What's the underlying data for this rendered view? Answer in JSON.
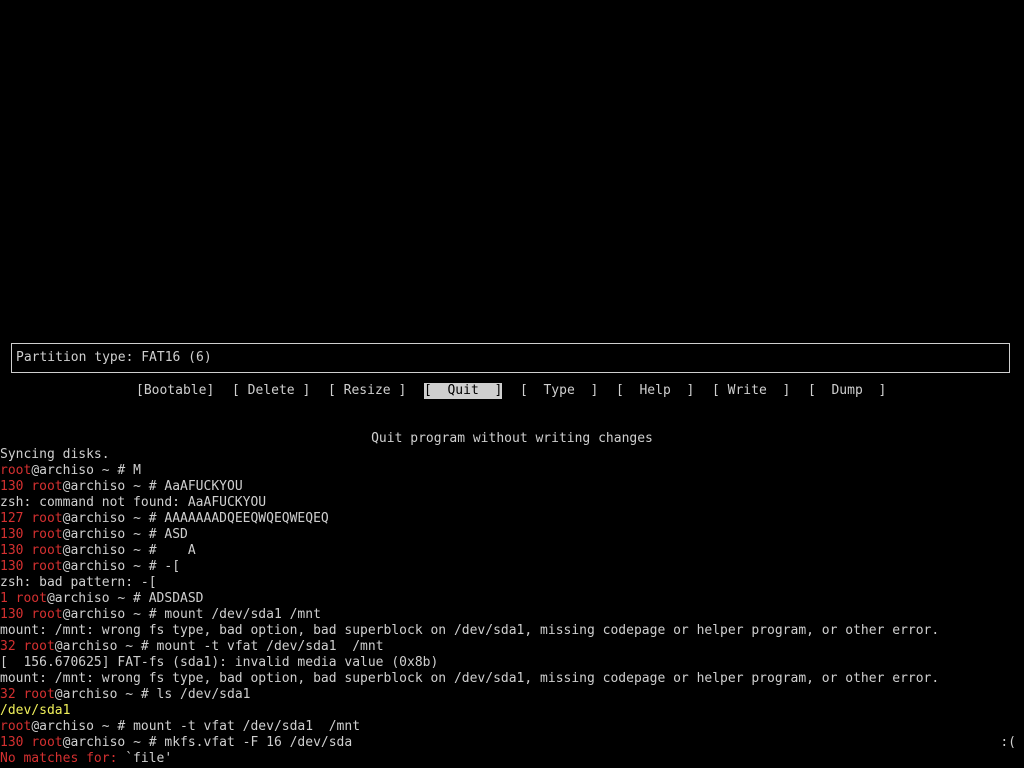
{
  "partition": {
    "type_line": "Partition type: FAT16 (6)"
  },
  "menu": {
    "items": [
      {
        "label": "[Bootable]"
      },
      {
        "label": "[ Delete ]"
      },
      {
        "label": "[ Resize ]"
      },
      {
        "label": "[  Quit  ]"
      },
      {
        "label": "[  Type  ]"
      },
      {
        "label": "[  Help  ]"
      },
      {
        "label": "[ Write  ]"
      },
      {
        "label": "[  Dump  ]"
      }
    ],
    "selected": "Quit"
  },
  "hint": "Quit program without writing changes",
  "terminal": {
    "lines": [
      {
        "text": "Syncing disks."
      },
      {
        "user": "root",
        "host": "@archiso ~ # ",
        "cmd": "M"
      },
      {
        "status": "130 ",
        "user": "root",
        "host": "@archiso ~ # ",
        "cmd": "AaAFUCKYOU"
      },
      {
        "text": "zsh: command not found: AaAFUCKYOU"
      },
      {
        "status": "127 ",
        "user": "root",
        "host": "@archiso ~ # ",
        "cmd": "AAAAAAADQEEQWQEQWEQEQ"
      },
      {
        "status": "130 ",
        "user": "root",
        "host": "@archiso ~ # ",
        "cmd": "ASD"
      },
      {
        "status": "130 ",
        "user": "root",
        "host": "@archiso ~ # ",
        "cmd": "   A"
      },
      {
        "status": "130 ",
        "user": "root",
        "host": "@archiso ~ # ",
        "cmd": "-["
      },
      {
        "text": "zsh: bad pattern: -["
      },
      {
        "status": "1 ",
        "user": "root",
        "host": "@archiso ~ # ",
        "cmd": "ADSDASD"
      },
      {
        "status": "130 ",
        "user": "root",
        "host": "@archiso ~ # ",
        "cmd": "mount /dev/sda1 /mnt"
      },
      {
        "text": "mount: /mnt: wrong fs type, bad option, bad superblock on /dev/sda1, missing codepage or helper program, or other error."
      },
      {
        "status": "32 ",
        "user": "root",
        "host": "@archiso ~ # ",
        "cmd": "mount -t vfat /dev/sda1  /mnt"
      },
      {
        "text": "[  156.670625] FAT-fs (sda1): invalid media value (0x8b)"
      },
      {
        "text": "mount: /mnt: wrong fs type, bad option, bad superblock on /dev/sda1, missing codepage or helper program, or other error."
      },
      {
        "status": "32 ",
        "user": "root",
        "host": "@archiso ~ # ",
        "cmd": "ls /dev/sda1"
      },
      {
        "highlight": "/dev/sda1"
      },
      {
        "user": "root",
        "host": "@archiso ~ # ",
        "cmd": "mount -t vfat /dev/sda1  /mnt"
      },
      {
        "status": "130 ",
        "user": "root",
        "host": "@archiso ~ # ",
        "cmd": "mkfs.vfat -F 16 /dev/sda"
      },
      {
        "error_label": "No matches for: ",
        "error_value": "`file'"
      }
    ],
    "right_status": ":("
  },
  "colors": {
    "background": "#000000",
    "foreground": "#cfcfcf",
    "prompt_red": "#d43030",
    "highlight_yellow": "#f0f05a"
  }
}
